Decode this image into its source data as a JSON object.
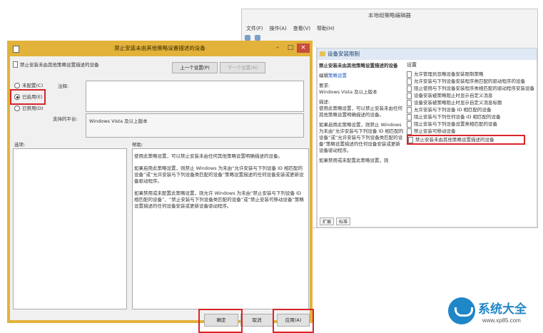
{
  "editor_window": {
    "title": "本地组策略编辑器",
    "menu": [
      "文件(F)",
      "操作(A)",
      "查看(V)",
      "帮助(H)"
    ],
    "panel_title": "设备安装限制",
    "desc_title": "禁止安装未由其他策略设置描述的设备",
    "edit_label": "编辑",
    "edit_link": "策略设置",
    "requirements_label": "要求:",
    "requirements_value": "Windows Vista 及以上版本",
    "description_label": "描述:",
    "description_text": "使用此策略设置，可以禁止安装未由任何其他策略设置明确描述的设备。",
    "enabled_text": "如果启用此策略设置，则禁止 Windows 为未由“允许安装与下列设备 ID 相匹配的设备”或“允许安装与下列设备类匹配的设备”策略设置描述的任何设备安装或更新设备驱动程序。",
    "disabled_text": "如果禁用或未配置此策略设置，则",
    "settings_header": "设置",
    "settings_items": [
      "允许管理员忽略设备安装限制策略",
      "允许安装与下列设备安装程序类匹配的驱动程序的设备",
      "阻止使用与下列设备安装程序类相匹配的驱动程序安装设备",
      "设备安装被策略阻止时显示自定义消息",
      "设备安装被策略阻止时显示自定义消息标题",
      "允许安装与下列设备 ID 相匹配的设备",
      "阻止安装与下列任何设备 ID 相匹配的设备",
      "阻止安装与下列设备设置类相匹配的设备",
      "禁止安装可移动设备",
      "禁止安装未由其他策略设置描述的设备"
    ],
    "tabs": [
      "扩展",
      "标准"
    ]
  },
  "dialog": {
    "title": "禁止安装未由其他策略设置描述的设备",
    "header_name": "禁止安装未由其他策略设置描述的设备",
    "prev_button": "上一个设置(P)",
    "next_button": "下一个设置(N)",
    "radio_not_configured": "未配置(C)",
    "radio_enabled": "已启用(E)",
    "radio_disabled": "已禁用(D)",
    "comment_label": "注释:",
    "supported_label": "支持的平台:",
    "supported_value": "Windows Vista 及以上版本",
    "options_label": "选项:",
    "help_label": "帮助:",
    "help_paragraphs": [
      "使用此策略设置，可以禁止安装未由任何其他策略设置明确描述的设备。",
      "如果启用此策略设置，则禁止 Windows 为未由“允许安装与下列设备 ID 相匹配的设备”或“允许安装与下列设备类匹配的设备”策略设置描述的任何设备安装或更新设备驱动程序。",
      "如果禁用或未配置此策略设置，则允许 Windows 为未由“禁止安装与下列设备 ID 相匹配的设备”、“禁止安装与下列设备类匹配的设备”或“禁止安装可移动设备”策略设置描述的任何设备安装或更新设备驱动程序。"
    ],
    "ok_button": "确定",
    "cancel_button": "取消",
    "apply_button": "应用(A)",
    "selected_option": "已启用(E)"
  },
  "watermark": {
    "name": "系统大全",
    "url": "www.xp85.com"
  },
  "colors": {
    "dialog_frame": "#e2b23a",
    "highlight_red": "#d9252a",
    "panel_header": "#dfe9f5"
  }
}
